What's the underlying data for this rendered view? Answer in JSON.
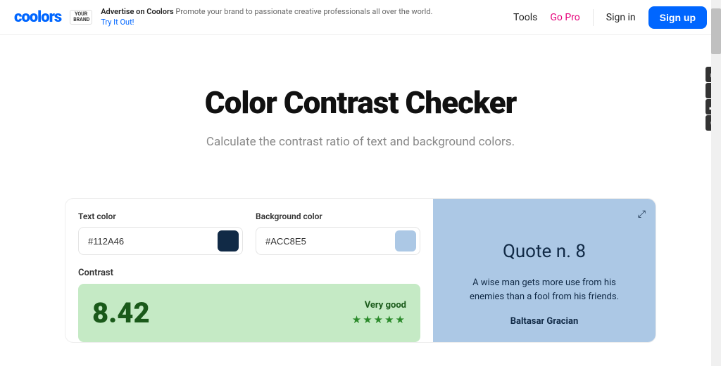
{
  "header": {
    "logo": "coolors",
    "brand_badge": "YOUR BRAND",
    "advert_title": "Advertise on Coolors",
    "advert_text": "Promote your brand to passionate creative professionals all over the world.",
    "advert_link": "Try It Out!",
    "nav": {
      "tools": "Tools",
      "go_pro": "Go Pro",
      "sign_in": "Sign in",
      "sign_up": "Sign up"
    }
  },
  "main": {
    "title": "Color Contrast Checker",
    "subtitle": "Calculate the contrast ratio of text and background colors."
  },
  "checker": {
    "text_color_label": "Text color",
    "text_color_value": "#112A46",
    "bg_color_label": "Background color",
    "bg_color_value": "#ACC8E5",
    "contrast_label": "Contrast",
    "contrast_value": "8.42",
    "rating_text": "Very good",
    "stars": "★★★★★"
  },
  "preview": {
    "quote_title": "Quote n. 8",
    "quote_text": "A wise man gets more use from his enemies than a fool from his friends.",
    "quote_author": "Baltasar Gracian"
  },
  "colors": {
    "text_swatch": "#112A46",
    "bg_swatch": "#ACC8E5"
  }
}
